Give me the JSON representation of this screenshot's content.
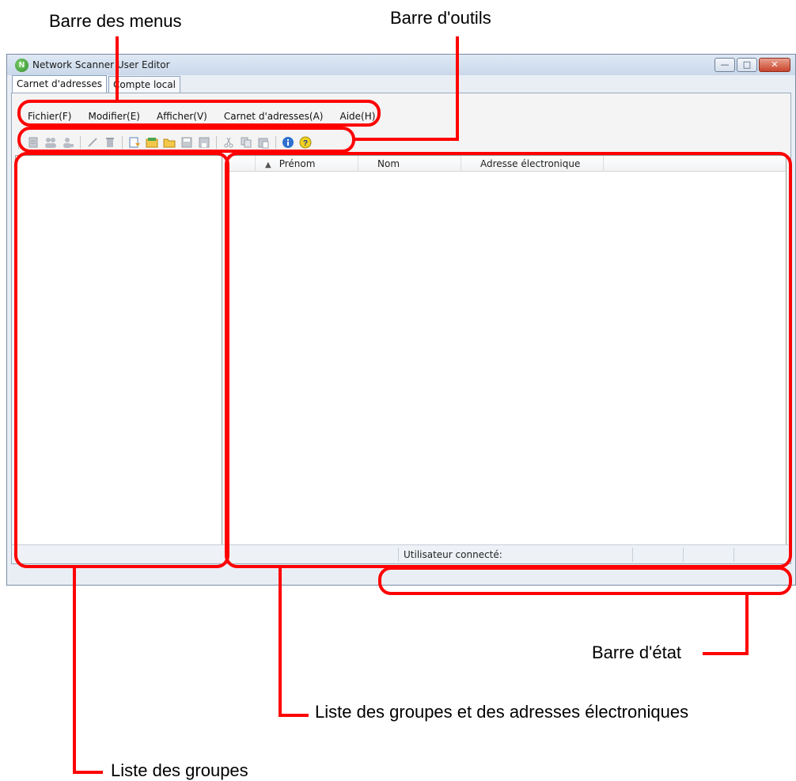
{
  "callouts": {
    "menubar": "Barre des menus",
    "toolbar": "Barre d'outils",
    "statusbar": "Barre d'état",
    "list_groups_addresses": "Liste des groupes et des adresses électroniques",
    "list_groups": "Liste des groupes"
  },
  "window": {
    "title": "Network Scanner User Editor",
    "app_icon_letter": "N",
    "minimize_glyph": "—",
    "maximize_glyph": "□",
    "close_glyph": "✕"
  },
  "tabs": [
    "Carnet d'adresses",
    "Compte local"
  ],
  "menu": [
    "Fichier(F)",
    "Modifier(E)",
    "Afficher(V)",
    "Carnet d'adresses(A)",
    "Aide(H)"
  ],
  "toolbar_icons": [
    "new-address-icon",
    "new-group-icon",
    "add-member-icon",
    "edit-icon",
    "delete-icon",
    "import-icon",
    "open-book-icon",
    "open-folder-icon",
    "save-as-icon",
    "save-icon",
    "cut-icon",
    "copy-icon",
    "paste-icon",
    "info-icon",
    "help-icon"
  ],
  "columns": {
    "first_name": "Prénom",
    "last_name": "Nom",
    "email": "Adresse électronique",
    "sort_glyph": "▲"
  },
  "status": {
    "logged_user_label": "Utilisateur connecté:"
  },
  "colors": {
    "annotation": "#ff0000",
    "window_frame": "#7a8ba3"
  }
}
